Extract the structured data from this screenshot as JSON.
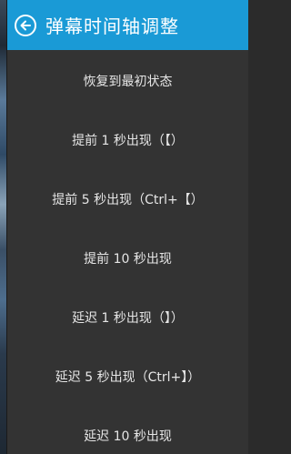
{
  "header": {
    "title": "弹幕时间轴调整",
    "back_icon": "arrow-left-circle-icon",
    "color": "#1a9ad6"
  },
  "menu": {
    "items": [
      {
        "label": "恢复到最初状态"
      },
      {
        "label": "提前 1 秒出现（【）"
      },
      {
        "label": "提前 5 秒出现（Ctrl+【）"
      },
      {
        "label": "提前 10 秒出现"
      },
      {
        "label": "延迟 1 秒出现（】）"
      },
      {
        "label": "延迟 5 秒出现（Ctrl+】）"
      },
      {
        "label": "延迟 10 秒出现"
      }
    ]
  }
}
